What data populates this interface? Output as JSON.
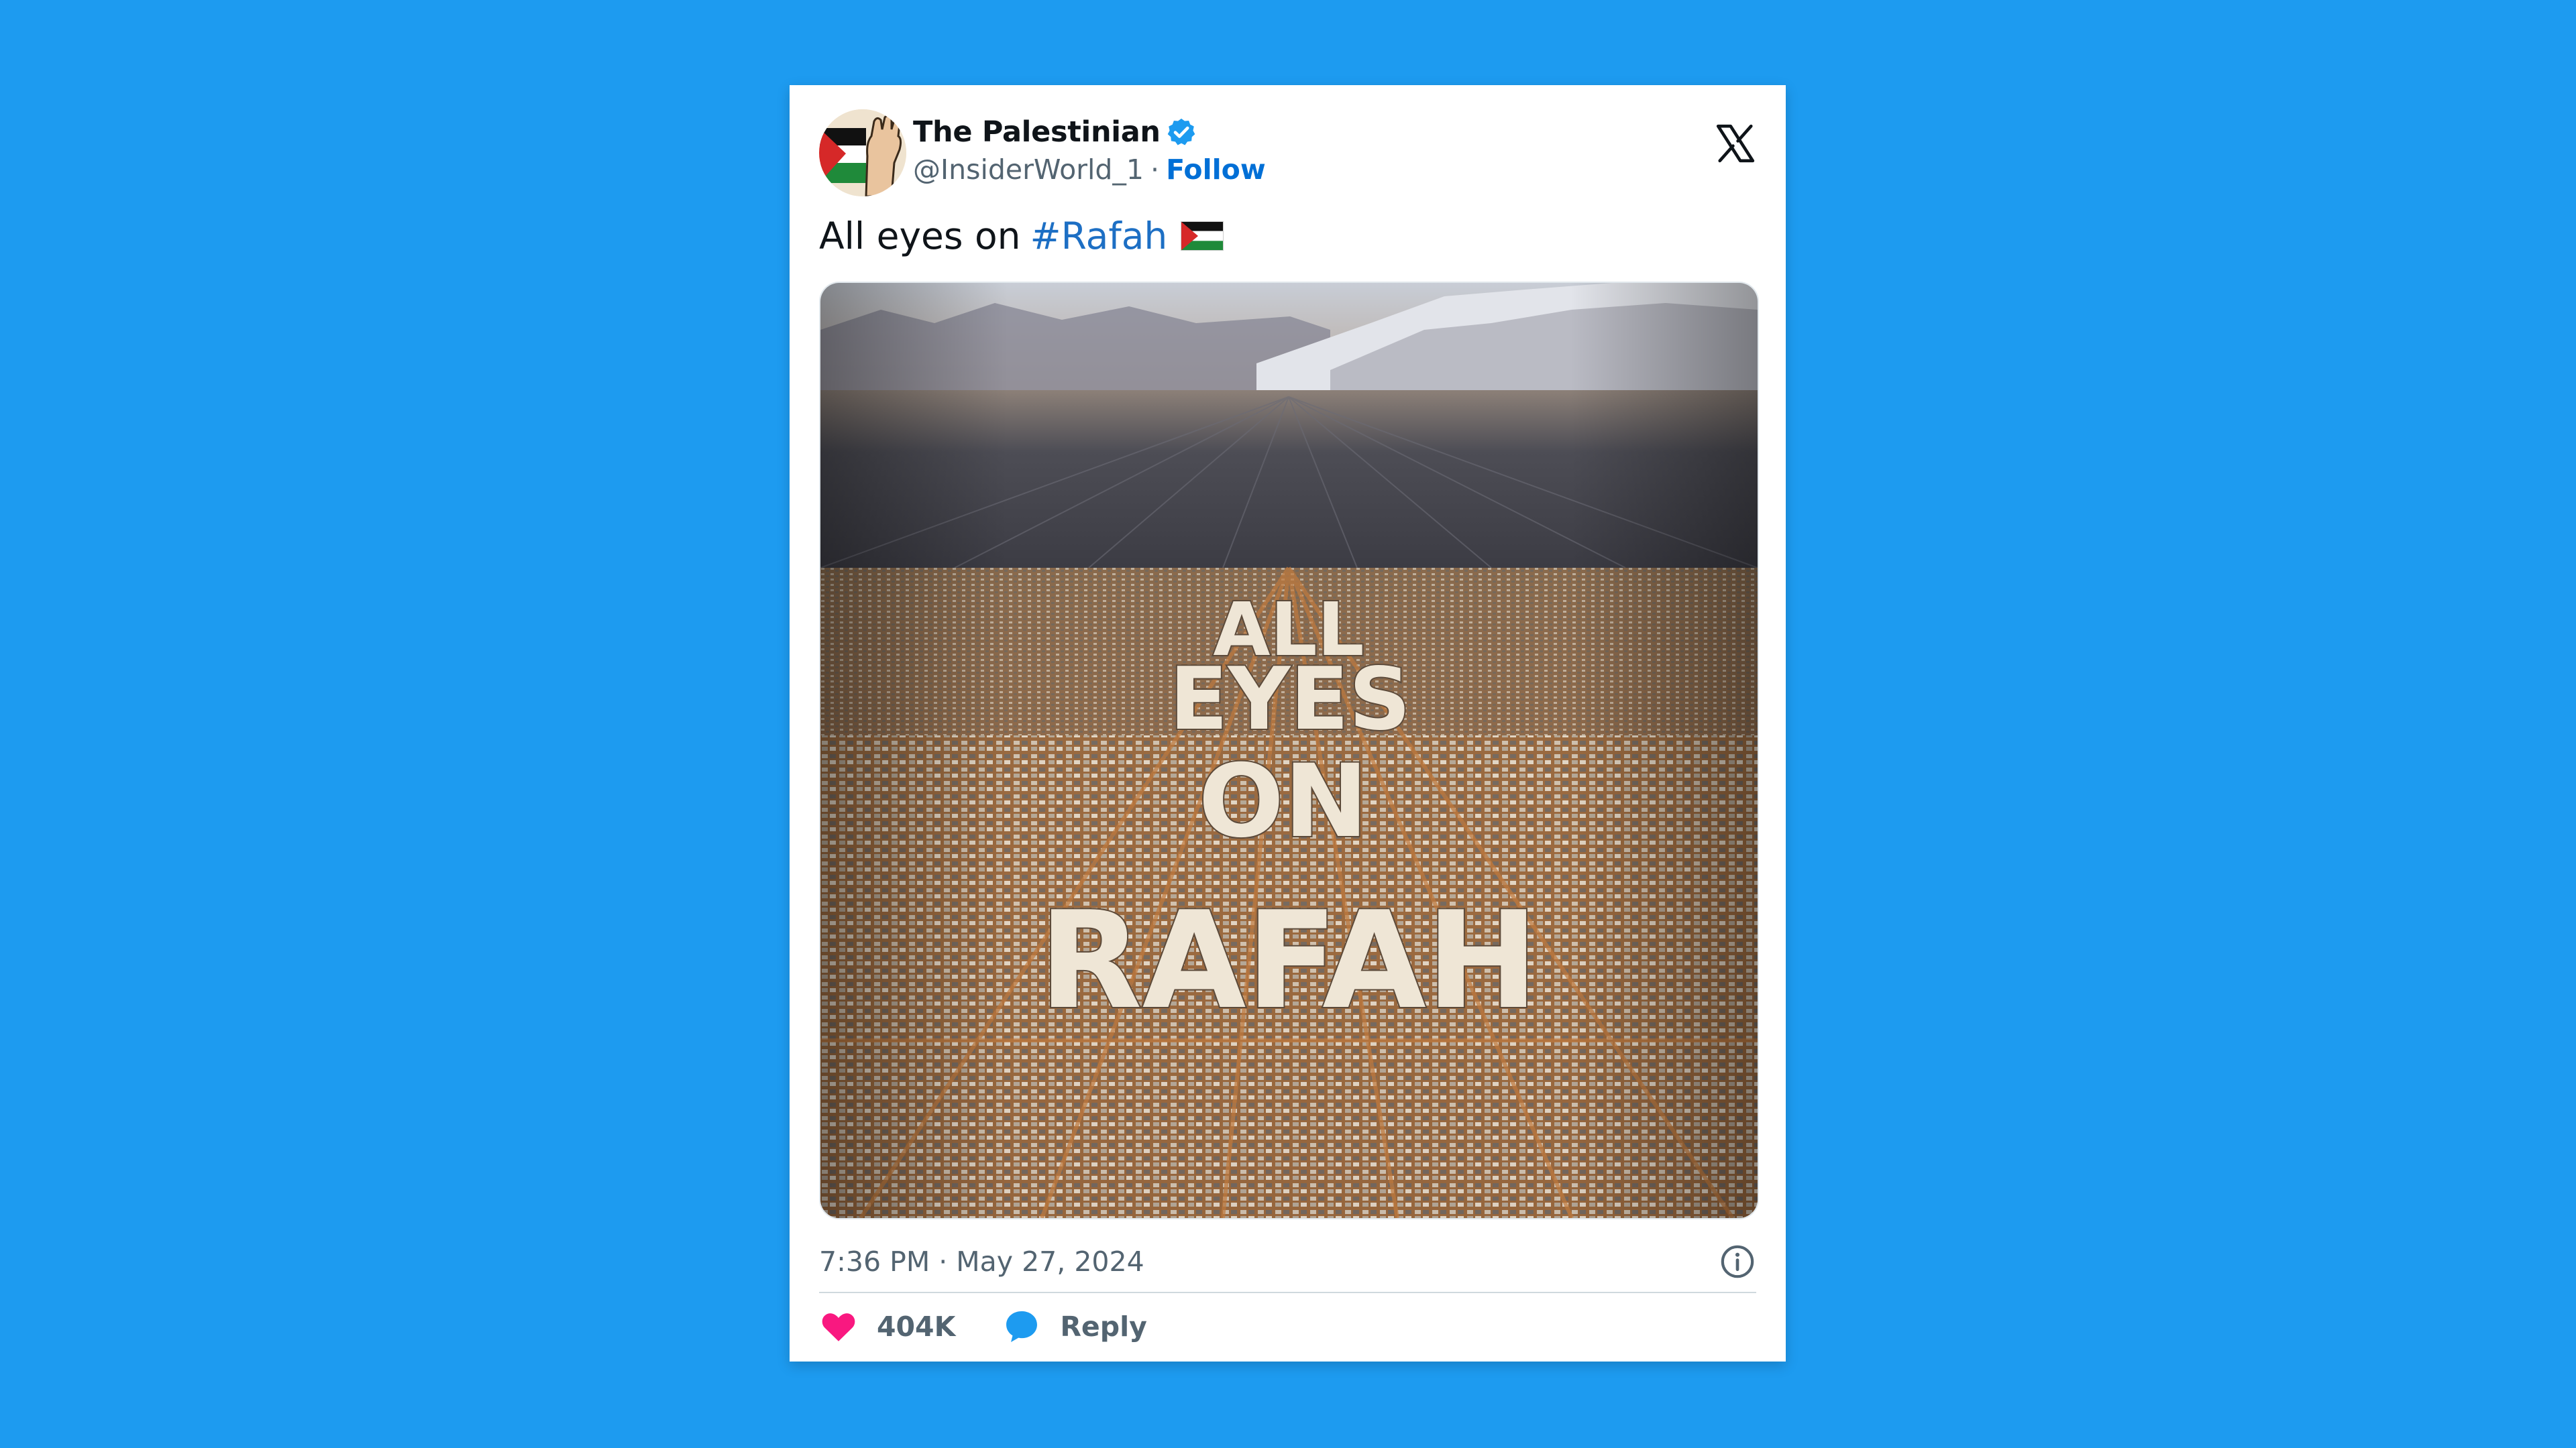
{
  "tweet": {
    "display_name": "The Palestinian",
    "handle": "@InsiderWorld_1",
    "separator": "·",
    "follow_label": "Follow",
    "text_prefix": "All eyes on",
    "hashtag": "#Rafah",
    "timestamp": "7:36 PM · May 27, 2024",
    "likes": "404K",
    "reply_label": "Reply",
    "image_text": {
      "line1": "ALL",
      "line2": "EYES",
      "line3": "ON",
      "line4": "RAFAH"
    }
  },
  "icons": {
    "verified": "verified-badge-icon",
    "brand": "x-logo-icon",
    "flag": "palestine-flag-icon",
    "info": "info-icon",
    "like": "heart-icon",
    "reply": "speech-bubble-icon"
  },
  "colors": {
    "background": "#1d9bf0",
    "link": "#006fd6",
    "hashtag": "#1d6fc4",
    "muted": "#536471",
    "heart": "#f91880",
    "reply_bubble": "#1d9bf0"
  }
}
